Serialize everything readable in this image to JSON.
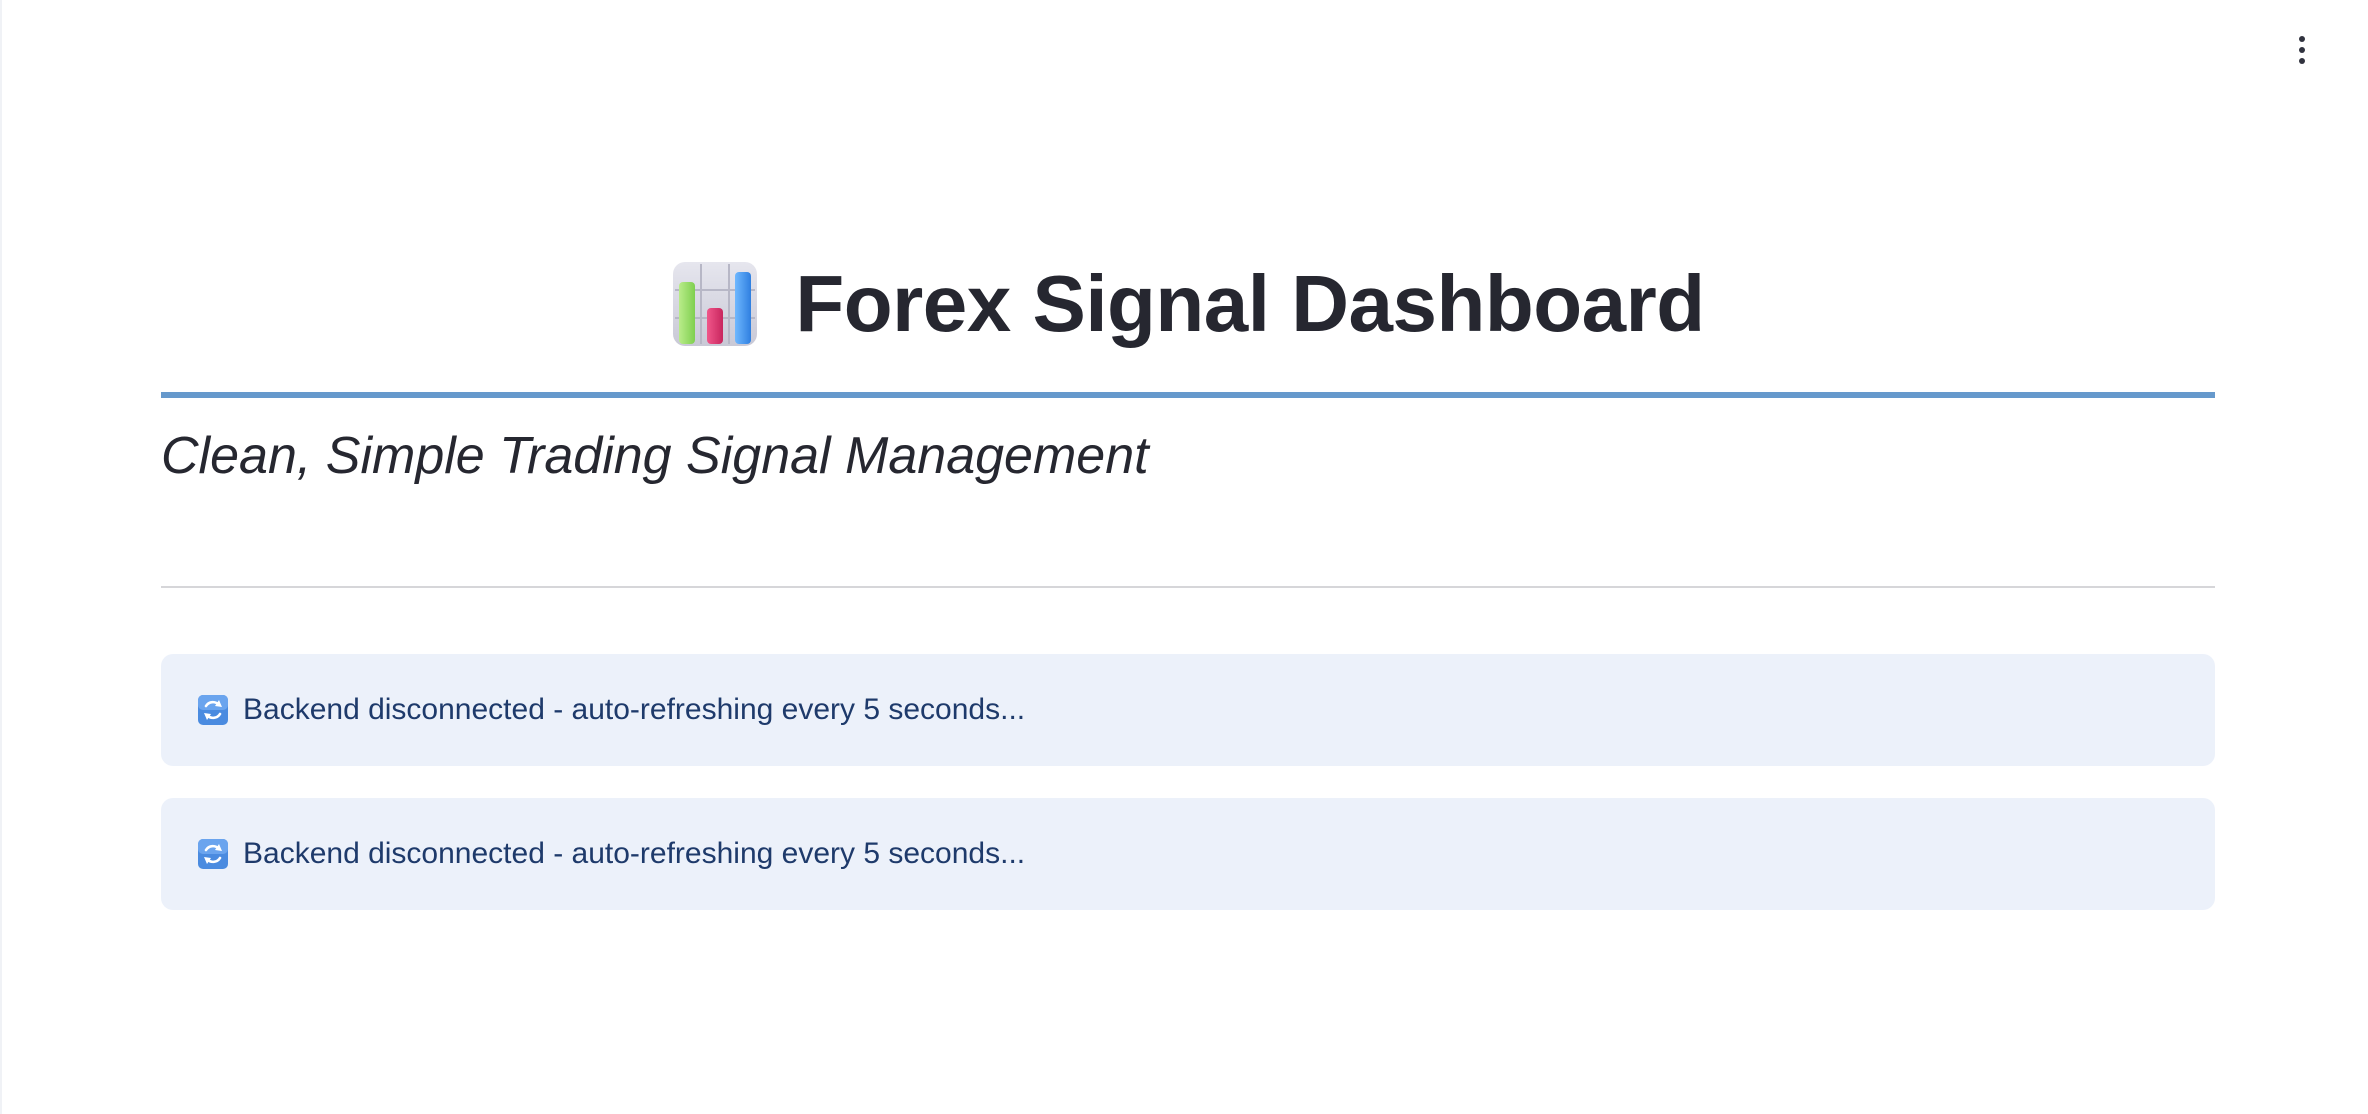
{
  "header": {
    "menu_icon": "vertical-ellipsis-icon"
  },
  "main": {
    "title_icon": "bar-chart-icon",
    "title": "Forex Signal Dashboard",
    "subtitle": "Clean, Simple Trading Signal Management",
    "accent_color": "#6699cc",
    "alerts": [
      {
        "icon": "arrows-counterclockwise-icon",
        "text": "Backend disconnected - auto-refreshing every 5 seconds..."
      },
      {
        "icon": "arrows-counterclockwise-icon",
        "text": "Backend disconnected - auto-refreshing every 5 seconds..."
      }
    ]
  }
}
